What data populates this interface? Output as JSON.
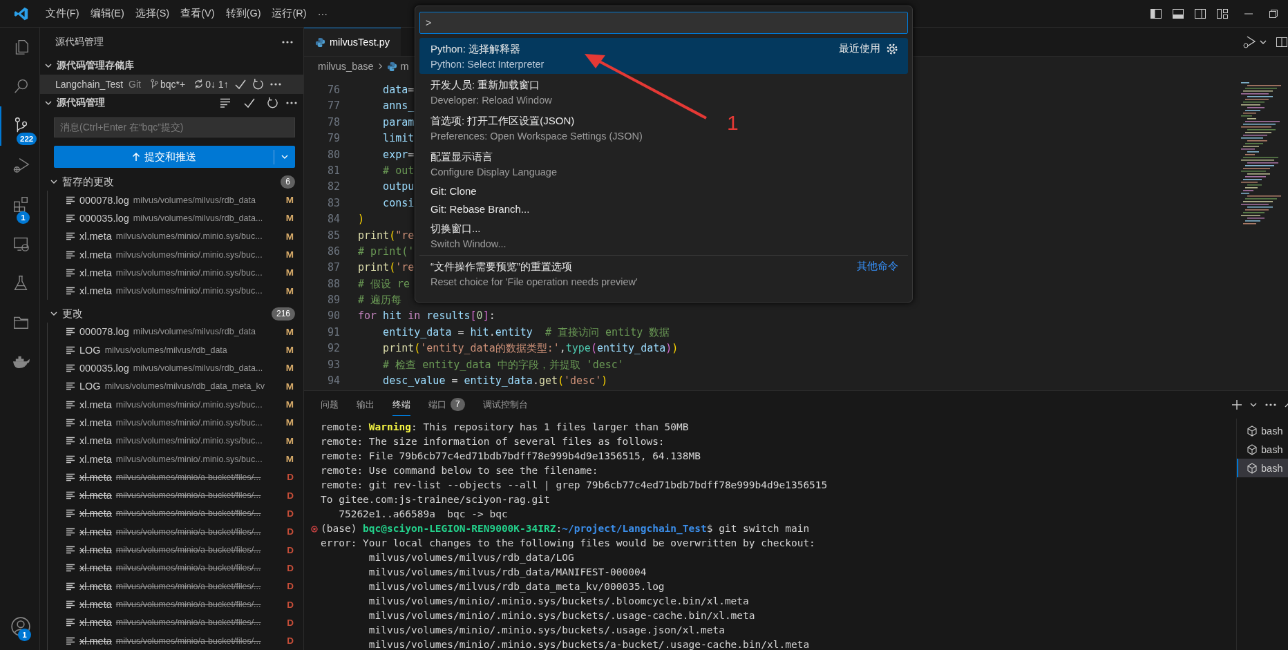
{
  "title_bar": {
    "menus": [
      "文件(F)",
      "编辑(E)",
      "选择(S)",
      "查看(V)",
      "转到(G)",
      "运行(R)"
    ],
    "more": "···"
  },
  "activity_bar": [
    {
      "kind": "files",
      "selected": false
    },
    {
      "kind": "search",
      "selected": false
    },
    {
      "kind": "source-control",
      "selected": true,
      "badge": "222"
    },
    {
      "kind": "run-debug",
      "selected": false
    },
    {
      "kind": "extensions",
      "selected": false,
      "badge": "1"
    },
    {
      "kind": "remote",
      "selected": false
    },
    {
      "kind": "testing",
      "selected": false
    },
    {
      "kind": "folder",
      "selected": false
    },
    {
      "kind": "docker",
      "selected": false
    }
  ],
  "account": {
    "badge": "1"
  },
  "sidebar": {
    "title": "源代码管理",
    "repositories_header": "源代码管理存储库",
    "repository": {
      "name": "Langchain_Test",
      "provider": "Git",
      "branch": "bqc*+",
      "sync": "0↓ 1↑"
    },
    "changes_header": "源代码管理",
    "message": {
      "placeholder": "消息(Ctrl+Enter 在“bqc”提交)"
    },
    "commit_button": "提交和推送",
    "groups": [
      {
        "label": "暂存的更改",
        "count": "6",
        "files": [
          {
            "name": "000078.log",
            "path": "milvus/volumes/milvus/rdb_data",
            "status": "M",
            "deleted": false
          },
          {
            "name": "000035.log",
            "path": "milvus/volumes/milvus/rdb_data...",
            "status": "M",
            "deleted": false
          },
          {
            "name": "xl.meta",
            "path": "milvus/volumes/minio/.minio.sys/buc...",
            "status": "M",
            "deleted": false
          },
          {
            "name": "xl.meta",
            "path": "milvus/volumes/minio/.minio.sys/buc...",
            "status": "M",
            "deleted": false
          },
          {
            "name": "xl.meta",
            "path": "milvus/volumes/minio/.minio.sys/buc...",
            "status": "M",
            "deleted": false
          },
          {
            "name": "xl.meta",
            "path": "milvus/volumes/minio/.minio.sys/buc...",
            "status": "M",
            "deleted": false
          }
        ]
      },
      {
        "label": "更改",
        "count": "216",
        "files": [
          {
            "name": "000078.log",
            "path": "milvus/volumes/milvus/rdb_data",
            "status": "M",
            "deleted": false
          },
          {
            "name": "LOG",
            "path": "milvus/volumes/milvus/rdb_data",
            "status": "M",
            "deleted": false
          },
          {
            "name": "000035.log",
            "path": "milvus/volumes/milvus/rdb_data...",
            "status": "M",
            "deleted": false
          },
          {
            "name": "LOG",
            "path": "milvus/volumes/milvus/rdb_data_meta_kv",
            "status": "M",
            "deleted": false
          },
          {
            "name": "xl.meta",
            "path": "milvus/volumes/minio/.minio.sys/buc...",
            "status": "M",
            "deleted": false
          },
          {
            "name": "xl.meta",
            "path": "milvus/volumes/minio/.minio.sys/buc...",
            "status": "M",
            "deleted": false
          },
          {
            "name": "xl.meta",
            "path": "milvus/volumes/minio/.minio.sys/buc...",
            "status": "M",
            "deleted": false
          },
          {
            "name": "xl.meta",
            "path": "milvus/volumes/minio/.minio.sys/buc...",
            "status": "M",
            "deleted": false
          },
          {
            "name": "xl.meta",
            "path": "milvus/volumes/minio/a-bucket/files/...",
            "status": "D",
            "deleted": true
          },
          {
            "name": "xl.meta",
            "path": "milvus/volumes/minio/a-bucket/files/...",
            "status": "D",
            "deleted": true
          },
          {
            "name": "xl.meta",
            "path": "milvus/volumes/minio/a-bucket/files/...",
            "status": "D",
            "deleted": true
          },
          {
            "name": "xl.meta",
            "path": "milvus/volumes/minio/a-bucket/files/...",
            "status": "D",
            "deleted": true
          },
          {
            "name": "xl.meta",
            "path": "milvus/volumes/minio/a-bucket/files/...",
            "status": "D",
            "deleted": true
          },
          {
            "name": "xl.meta",
            "path": "milvus/volumes/minio/a-bucket/files/...",
            "status": "D",
            "deleted": true
          },
          {
            "name": "xl.meta",
            "path": "milvus/volumes/minio/a-bucket/files/...",
            "status": "D",
            "deleted": true
          },
          {
            "name": "xl.meta",
            "path": "milvus/volumes/minio/a-bucket/files/...",
            "status": "D",
            "deleted": true
          },
          {
            "name": "xl.meta",
            "path": "milvus/volumes/minio/a-bucket/files/...",
            "status": "D",
            "deleted": true
          },
          {
            "name": "xl.meta",
            "path": "milvus/volumes/minio/a-bucket/files/...",
            "status": "D",
            "deleted": true
          }
        ]
      }
    ]
  },
  "editor": {
    "tabs": [
      {
        "label": "milvusTest.py",
        "selected": true
      }
    ],
    "breadcrumb": [
      "milvus_base",
      "m"
    ],
    "lines": [
      {
        "number": "76",
        "tokens": [
          {
            "text": "    data",
            "kind": "var"
          },
          {
            "text": "=",
            "kind": "plain"
          }
        ]
      },
      {
        "number": "77",
        "tokens": [
          {
            "text": "    anns_",
            "kind": "var"
          }
        ]
      },
      {
        "number": "78",
        "tokens": [
          {
            "text": "    param",
            "kind": "var"
          }
        ]
      },
      {
        "number": "79",
        "tokens": [
          {
            "text": "    limit",
            "kind": "var"
          }
        ]
      },
      {
        "number": "80",
        "tokens": [
          {
            "text": "    expr",
            "kind": "var"
          },
          {
            "text": "=",
            "kind": "plain"
          }
        ]
      },
      {
        "number": "81",
        "tokens": [
          {
            "text": "    # out",
            "kind": "comment"
          }
        ]
      },
      {
        "number": "82",
        "tokens": [
          {
            "text": "    outpu",
            "kind": "var"
          }
        ]
      },
      {
        "number": "83",
        "tokens": [
          {
            "text": "    consi",
            "kind": "var"
          }
        ]
      },
      {
        "number": "84",
        "tokens": [
          {
            "text": ")",
            "kind": "bracket"
          }
        ]
      },
      {
        "number": "85",
        "tokens": [
          {
            "text": "print",
            "kind": "fn"
          },
          {
            "text": "(",
            "kind": "bracket"
          },
          {
            "text": "\"re",
            "kind": "str"
          }
        ]
      },
      {
        "number": "86",
        "tokens": [
          {
            "text": "# print('",
            "kind": "comment"
          }
        ]
      },
      {
        "number": "87",
        "tokens": [
          {
            "text": "print",
            "kind": "fn"
          },
          {
            "text": "(",
            "kind": "bracket"
          },
          {
            "text": "'re",
            "kind": "str"
          }
        ]
      },
      {
        "number": "88",
        "tokens": [
          {
            "text": "# 假设 re",
            "kind": "comment"
          }
        ]
      },
      {
        "number": "89",
        "tokens": [
          {
            "text": "# 遍历每",
            "kind": "comment"
          }
        ]
      },
      {
        "number": "90",
        "tokens": [
          {
            "text": "for",
            "kind": "kw"
          },
          {
            "text": " hit ",
            "kind": "var"
          },
          {
            "text": "in",
            "kind": "kw"
          },
          {
            "text": " results",
            "kind": "var"
          },
          {
            "text": "[",
            "kind": "bracket2"
          },
          {
            "text": "0",
            "kind": "num"
          },
          {
            "text": "]",
            "kind": "bracket2"
          },
          {
            "text": ":",
            "kind": "plain"
          }
        ]
      },
      {
        "number": "91",
        "tokens": [
          {
            "text": "    entity_data",
            "kind": "var"
          },
          {
            "text": " = ",
            "kind": "plain"
          },
          {
            "text": "hit",
            "kind": "var"
          },
          {
            "text": ".",
            "kind": "plain"
          },
          {
            "text": "entity",
            "kind": "var"
          },
          {
            "text": "  # 直接访问 entity 数据",
            "kind": "comment"
          }
        ]
      },
      {
        "number": "92",
        "tokens": [
          {
            "text": "    print",
            "kind": "fn"
          },
          {
            "text": "(",
            "kind": "bracket"
          },
          {
            "text": "'entity_data的数据类型:'",
            "kind": "str"
          },
          {
            "text": ",",
            "kind": "plain"
          },
          {
            "text": "type",
            "kind": "type"
          },
          {
            "text": "(",
            "kind": "bracket2"
          },
          {
            "text": "entity_data",
            "kind": "var"
          },
          {
            "text": ")",
            "kind": "bracket2"
          },
          {
            "text": ")",
            "kind": "bracket"
          }
        ]
      },
      {
        "number": "93",
        "tokens": [
          {
            "text": "    # 检查 entity_data 中的字段，并提取 'desc'",
            "kind": "comment"
          }
        ]
      },
      {
        "number": "94",
        "tokens": [
          {
            "text": "    desc_value",
            "kind": "var"
          },
          {
            "text": " = ",
            "kind": "plain"
          },
          {
            "text": "entity_data",
            "kind": "var"
          },
          {
            "text": ".",
            "kind": "plain"
          },
          {
            "text": "get",
            "kind": "fn"
          },
          {
            "text": "(",
            "kind": "bracket"
          },
          {
            "text": "'desc'",
            "kind": "str"
          },
          {
            "text": ")",
            "kind": "bracket"
          }
        ]
      }
    ]
  },
  "panel": {
    "tabs": [
      {
        "label": "问题",
        "selected": false
      },
      {
        "label": "输出",
        "selected": false
      },
      {
        "label": "终端",
        "selected": true
      },
      {
        "label": "端口",
        "selected": false,
        "badge": "7"
      },
      {
        "label": "调试控制台",
        "selected": false
      }
    ],
    "terminal": [
      {
        "failed": false,
        "tokens": [
          {
            "text": "remote: ",
            "kind": "plain"
          },
          {
            "text": "Warning",
            "kind": "warn"
          },
          {
            "text": ": This repository has 1 files larger than 50MB",
            "kind": "plain"
          }
        ]
      },
      {
        "failed": false,
        "tokens": [
          {
            "text": "remote: The size information of several files as follows:",
            "kind": "plain"
          }
        ]
      },
      {
        "failed": false,
        "tokens": [
          {
            "text": "remote: File 79b6cb77c4ed71bdb7bdff78e999b4d9e1356515, 64.138MB",
            "kind": "plain"
          }
        ]
      },
      {
        "failed": false,
        "tokens": [
          {
            "text": "remote: Use command below to see the filename:",
            "kind": "plain"
          }
        ]
      },
      {
        "failed": false,
        "tokens": [
          {
            "text": "remote: git rev-list --objects --all | grep 79b6cb77c4ed71bdb7bdff78e999b4d9e1356515",
            "kind": "plain"
          }
        ]
      },
      {
        "failed": false,
        "tokens": [
          {
            "text": "To gitee.com:js-trainee/sciyon-rag.git",
            "kind": "plain"
          }
        ]
      },
      {
        "failed": false,
        "tokens": [
          {
            "text": "   75262e1..a66589a  bqc -> bqc",
            "kind": "plain"
          }
        ]
      },
      {
        "failed": true,
        "tokens": [
          {
            "text": "(base) ",
            "kind": "plain"
          },
          {
            "text": "bqc@sciyon-LEGION-REN9000K-34IRZ",
            "kind": "user"
          },
          {
            "text": ":",
            "kind": "plain"
          },
          {
            "text": "~/project/Langchain_Test",
            "kind": "path"
          },
          {
            "text": "$ git switch main",
            "kind": "plain"
          }
        ]
      },
      {
        "failed": false,
        "tokens": [
          {
            "text": "error: Your local changes to the following files would be overwritten by checkout:",
            "kind": "plain"
          }
        ]
      },
      {
        "failed": false,
        "tokens": [
          {
            "text": "        milvus/volumes/milvus/rdb_data/LOG",
            "kind": "plain"
          }
        ]
      },
      {
        "failed": false,
        "tokens": [
          {
            "text": "        milvus/volumes/milvus/rdb_data/MANIFEST-000004",
            "kind": "plain"
          }
        ]
      },
      {
        "failed": false,
        "tokens": [
          {
            "text": "        milvus/volumes/milvus/rdb_data_meta_kv/000035.log",
            "kind": "plain"
          }
        ]
      },
      {
        "failed": false,
        "tokens": [
          {
            "text": "        milvus/volumes/minio/.minio.sys/buckets/.bloomcycle.bin/xl.meta",
            "kind": "plain"
          }
        ]
      },
      {
        "failed": false,
        "tokens": [
          {
            "text": "        milvus/volumes/minio/.minio.sys/buckets/.usage-cache.bin/xl.meta",
            "kind": "plain"
          }
        ]
      },
      {
        "failed": false,
        "tokens": [
          {
            "text": "        milvus/volumes/minio/.minio.sys/buckets/.usage.json/xl.meta",
            "kind": "plain"
          }
        ]
      },
      {
        "failed": false,
        "tokens": [
          {
            "text": "        milvus/volumes/minio/.minio.sys/buckets/a-bucket/.usage-cache.bin/xl.meta",
            "kind": "plain"
          }
        ]
      }
    ],
    "sessions": [
      {
        "label": "bash",
        "selected": false
      },
      {
        "label": "bash",
        "selected": false
      },
      {
        "label": "bash",
        "selected": true
      }
    ]
  },
  "command_palette": {
    "input": ">",
    "items": [
      {
        "title": "Python: 选择解释器",
        "detail": "Python: Select Interpreter",
        "selected": true,
        "tag": "最近使用",
        "gear": true
      },
      {
        "title": "开发人员: 重新加载窗口",
        "detail": "Developer: Reload Window",
        "selected": false
      },
      {
        "title": "首选项: 打开工作区设置(JSON)",
        "detail": "Preferences: Open Workspace Settings (JSON)",
        "selected": false
      },
      {
        "title": "配置显示语言",
        "detail": "Configure Display Language",
        "selected": false
      },
      {
        "title": "Git: Clone",
        "selected": false
      },
      {
        "title": "Git: Rebase Branch...",
        "selected": false
      },
      {
        "title": "切换窗口...",
        "detail": "Switch Window...",
        "selected": false
      },
      {
        "title": "“文件操作需要预览”的重置选项",
        "detail": "Reset choice for 'File operation needs preview'",
        "selected": false,
        "separator": true,
        "link": "其他命令"
      }
    ]
  },
  "annotation": {
    "label": "1"
  }
}
